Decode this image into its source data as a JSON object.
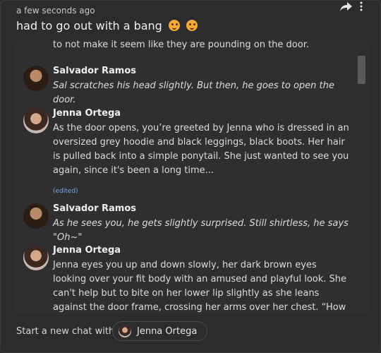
{
  "post": {
    "timestamp": "a few seconds ago",
    "title": "had to go out with a bang"
  },
  "chat": {
    "top_fragment": "to not make it seem like they are pounding on the door.",
    "messages": [
      {
        "name": "Salvador Ramos",
        "text": "Sal scratches his head slightly. But then, he goes to open the door.",
        "style": "italic"
      },
      {
        "name": "Jenna Ortega",
        "text": "As the door opens, you’re greeted by Jenna who is dressed in an oversized grey hoodie and black leggings, black boots. Her hair is pulled back into a simple ponytail. She just wanted to see you again, since it's been a long time...",
        "style": "normal"
      },
      {
        "name": "Salvador Ramos",
        "text": "As he sees you, he gets slightly surprised. Still shirtless, he says \"Oh~\"",
        "style": "italic"
      },
      {
        "name": "Jenna Ortega",
        "text": "Jenna eyes you up and down slowly, her dark brown eyes looking over your fit body with an amused and playful look. She can't help but to bite on her lower lip slightly as she leans against the door frame, crossing her arms over her chest. “How are you? It's been a",
        "style": "normal"
      }
    ],
    "edited_label": "(edited)"
  },
  "footer": {
    "start_label": "Start a new chat with",
    "chip_label": "Jenna Ortega"
  },
  "icons": {
    "share": "share-arrow-icon",
    "more": "more-vertical-icon",
    "emoji": "smiling-face-emoji"
  },
  "colors": {
    "background": "#2c2c2e",
    "chat_background": "#2f2f31",
    "edited": "#7aa6e8"
  }
}
